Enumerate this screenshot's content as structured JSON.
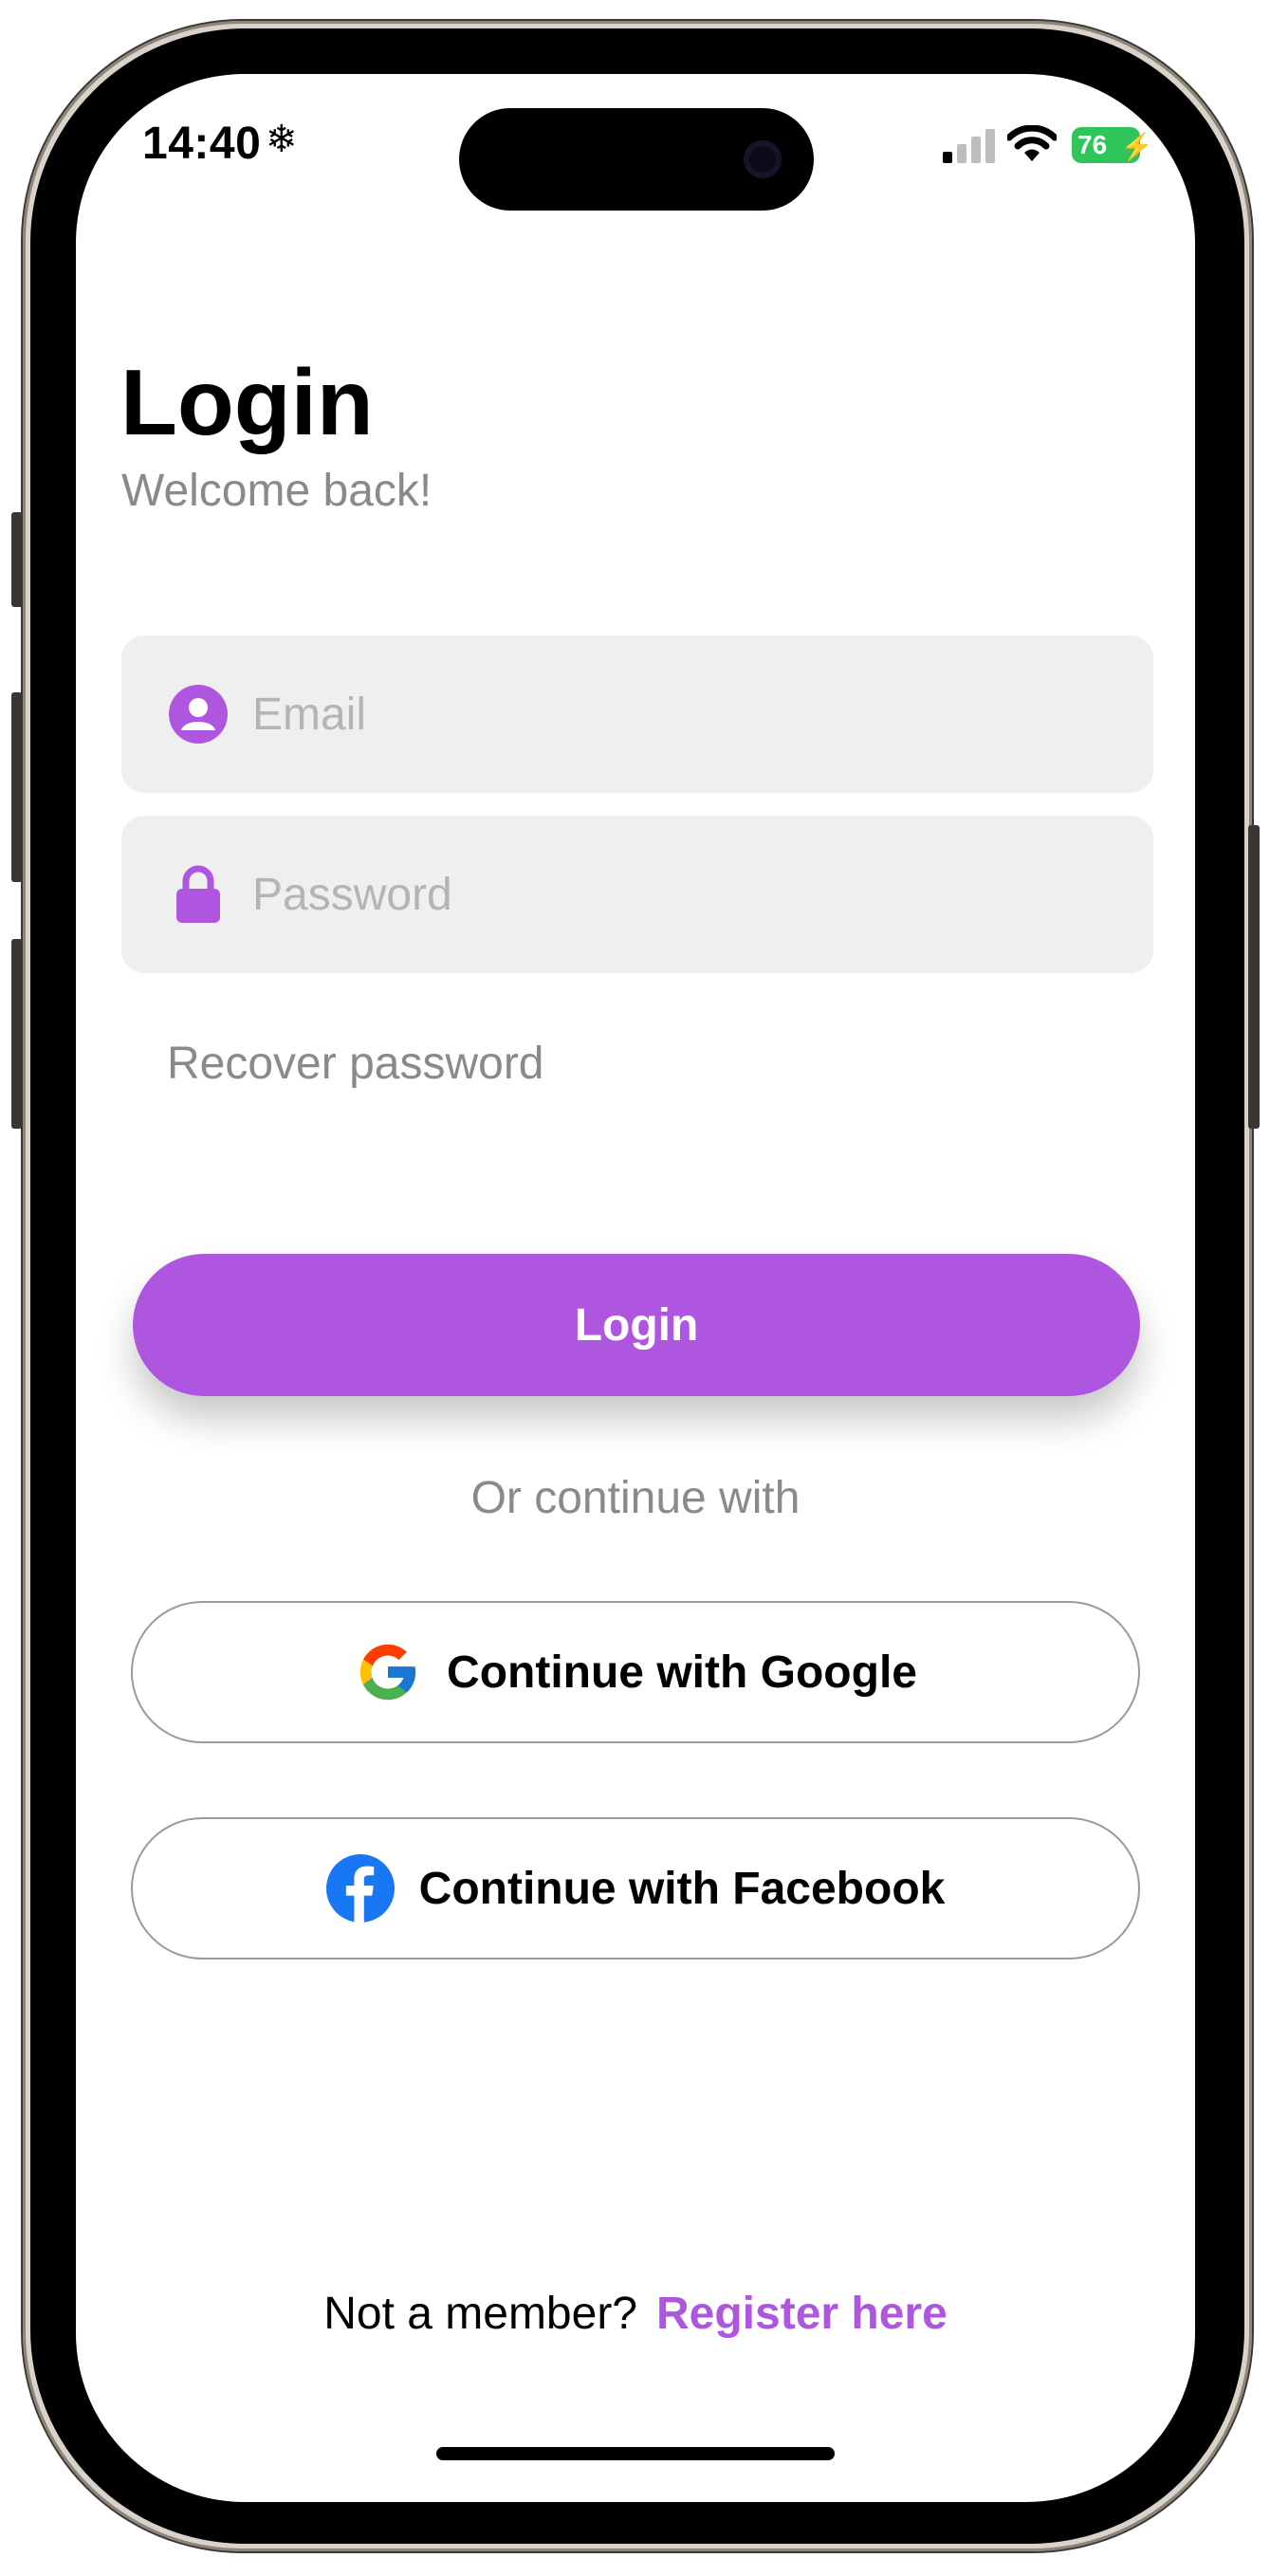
{
  "status_bar": {
    "time": "14:40",
    "time_indicator_icon": "snowflake-icon",
    "signal_icon": "cellular-signal-icon",
    "wifi_icon": "wifi-icon",
    "battery_level": "76",
    "battery_color": "#30c55b"
  },
  "header": {
    "title": "Login",
    "subtitle": "Welcome back!"
  },
  "form": {
    "email": {
      "icon": "person-icon",
      "placeholder": "Email",
      "value": ""
    },
    "password": {
      "icon": "lock-icon",
      "placeholder": "Password",
      "value": ""
    },
    "recover_label": "Recover password",
    "login_label": "Login"
  },
  "social": {
    "divider_label": "Or continue with",
    "google_label": "Continue with Google",
    "google_icon": "google-icon",
    "facebook_label": "Continue with Facebook",
    "facebook_icon": "facebook-icon"
  },
  "footer": {
    "prompt": "Not a member?",
    "register_label": "Register here"
  },
  "colors": {
    "accent": "#ae56df",
    "field_background": "#efefef",
    "secondary_text": "#8a8a8a",
    "facebook_blue": "#1877f2"
  }
}
